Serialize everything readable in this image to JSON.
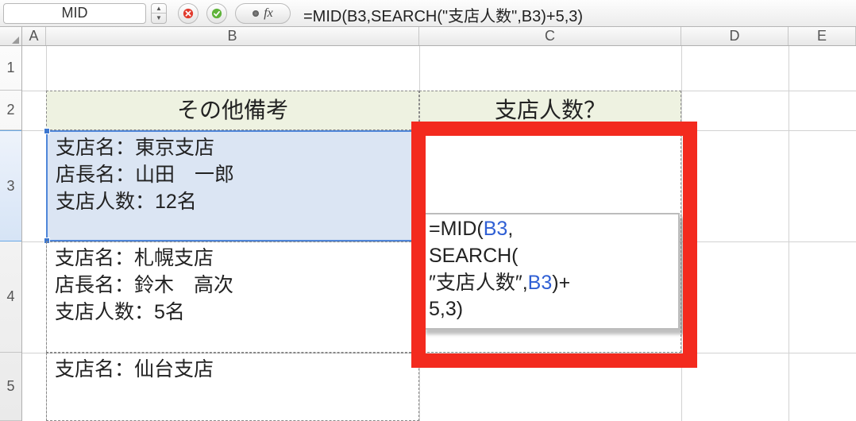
{
  "name_box": "MID",
  "formula_bar": "=MID(B3,SEARCH(\"支店人数\",B3)+5,3)",
  "columns": [
    "A",
    "B",
    "C",
    "D",
    "E"
  ],
  "col_widths": {
    "A": 30,
    "B": 470,
    "C": 330,
    "D": 135,
    "E": 85
  },
  "rows": [
    {
      "label": "1",
      "height": 56
    },
    {
      "label": "2",
      "height": 50
    },
    {
      "label": "3",
      "height": 140
    },
    {
      "label": "4",
      "height": 140
    },
    {
      "label": "5",
      "height": 86
    }
  ],
  "headers": {
    "b2": "その他備考",
    "c2": "支店人数？"
  },
  "data": {
    "b3": "支店名：東京支店\n店長名：山田　一郎\n支店人数：12名",
    "b4": "支店名：札幌支店\n店長名：鈴木　高次\n支店人数：5名",
    "b5": "支店名：仙台支店"
  },
  "formula_display": {
    "parts": [
      {
        "t": "=MID(",
        "c": ""
      },
      {
        "t": "B3",
        "c": "blue"
      },
      {
        "t": ",\nSEARCH(\n″支店人数″,",
        "c": ""
      },
      {
        "t": "B3",
        "c": "blue"
      },
      {
        "t": ")+\n5,3)",
        "c": ""
      }
    ]
  }
}
